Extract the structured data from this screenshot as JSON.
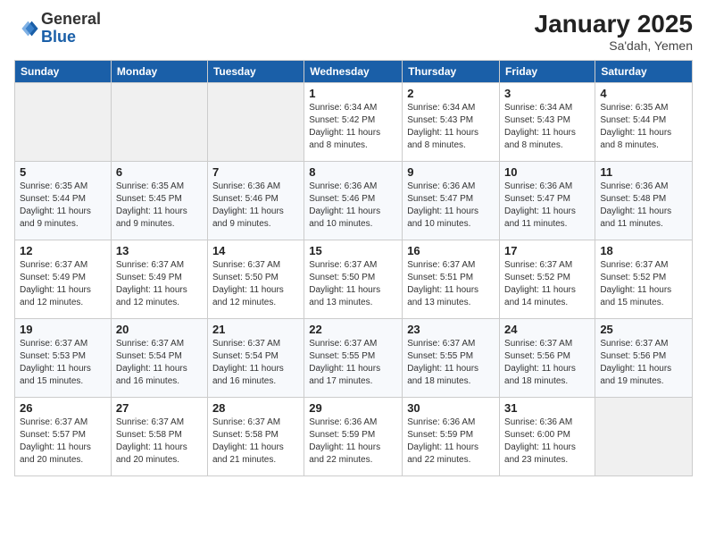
{
  "logo": {
    "line1": "General",
    "line2": "Blue"
  },
  "title": "January 2025",
  "subtitle": "Sa'dah, Yemen",
  "weekdays": [
    "Sunday",
    "Monday",
    "Tuesday",
    "Wednesday",
    "Thursday",
    "Friday",
    "Saturday"
  ],
  "weeks": [
    [
      {
        "day": "",
        "info": ""
      },
      {
        "day": "",
        "info": ""
      },
      {
        "day": "",
        "info": ""
      },
      {
        "day": "1",
        "info": "Sunrise: 6:34 AM\nSunset: 5:42 PM\nDaylight: 11 hours\nand 8 minutes."
      },
      {
        "day": "2",
        "info": "Sunrise: 6:34 AM\nSunset: 5:43 PM\nDaylight: 11 hours\nand 8 minutes."
      },
      {
        "day": "3",
        "info": "Sunrise: 6:34 AM\nSunset: 5:43 PM\nDaylight: 11 hours\nand 8 minutes."
      },
      {
        "day": "4",
        "info": "Sunrise: 6:35 AM\nSunset: 5:44 PM\nDaylight: 11 hours\nand 8 minutes."
      }
    ],
    [
      {
        "day": "5",
        "info": "Sunrise: 6:35 AM\nSunset: 5:44 PM\nDaylight: 11 hours\nand 9 minutes."
      },
      {
        "day": "6",
        "info": "Sunrise: 6:35 AM\nSunset: 5:45 PM\nDaylight: 11 hours\nand 9 minutes."
      },
      {
        "day": "7",
        "info": "Sunrise: 6:36 AM\nSunset: 5:46 PM\nDaylight: 11 hours\nand 9 minutes."
      },
      {
        "day": "8",
        "info": "Sunrise: 6:36 AM\nSunset: 5:46 PM\nDaylight: 11 hours\nand 10 minutes."
      },
      {
        "day": "9",
        "info": "Sunrise: 6:36 AM\nSunset: 5:47 PM\nDaylight: 11 hours\nand 10 minutes."
      },
      {
        "day": "10",
        "info": "Sunrise: 6:36 AM\nSunset: 5:47 PM\nDaylight: 11 hours\nand 11 minutes."
      },
      {
        "day": "11",
        "info": "Sunrise: 6:36 AM\nSunset: 5:48 PM\nDaylight: 11 hours\nand 11 minutes."
      }
    ],
    [
      {
        "day": "12",
        "info": "Sunrise: 6:37 AM\nSunset: 5:49 PM\nDaylight: 11 hours\nand 12 minutes."
      },
      {
        "day": "13",
        "info": "Sunrise: 6:37 AM\nSunset: 5:49 PM\nDaylight: 11 hours\nand 12 minutes."
      },
      {
        "day": "14",
        "info": "Sunrise: 6:37 AM\nSunset: 5:50 PM\nDaylight: 11 hours\nand 12 minutes."
      },
      {
        "day": "15",
        "info": "Sunrise: 6:37 AM\nSunset: 5:50 PM\nDaylight: 11 hours\nand 13 minutes."
      },
      {
        "day": "16",
        "info": "Sunrise: 6:37 AM\nSunset: 5:51 PM\nDaylight: 11 hours\nand 13 minutes."
      },
      {
        "day": "17",
        "info": "Sunrise: 6:37 AM\nSunset: 5:52 PM\nDaylight: 11 hours\nand 14 minutes."
      },
      {
        "day": "18",
        "info": "Sunrise: 6:37 AM\nSunset: 5:52 PM\nDaylight: 11 hours\nand 15 minutes."
      }
    ],
    [
      {
        "day": "19",
        "info": "Sunrise: 6:37 AM\nSunset: 5:53 PM\nDaylight: 11 hours\nand 15 minutes."
      },
      {
        "day": "20",
        "info": "Sunrise: 6:37 AM\nSunset: 5:54 PM\nDaylight: 11 hours\nand 16 minutes."
      },
      {
        "day": "21",
        "info": "Sunrise: 6:37 AM\nSunset: 5:54 PM\nDaylight: 11 hours\nand 16 minutes."
      },
      {
        "day": "22",
        "info": "Sunrise: 6:37 AM\nSunset: 5:55 PM\nDaylight: 11 hours\nand 17 minutes."
      },
      {
        "day": "23",
        "info": "Sunrise: 6:37 AM\nSunset: 5:55 PM\nDaylight: 11 hours\nand 18 minutes."
      },
      {
        "day": "24",
        "info": "Sunrise: 6:37 AM\nSunset: 5:56 PM\nDaylight: 11 hours\nand 18 minutes."
      },
      {
        "day": "25",
        "info": "Sunrise: 6:37 AM\nSunset: 5:56 PM\nDaylight: 11 hours\nand 19 minutes."
      }
    ],
    [
      {
        "day": "26",
        "info": "Sunrise: 6:37 AM\nSunset: 5:57 PM\nDaylight: 11 hours\nand 20 minutes."
      },
      {
        "day": "27",
        "info": "Sunrise: 6:37 AM\nSunset: 5:58 PM\nDaylight: 11 hours\nand 20 minutes."
      },
      {
        "day": "28",
        "info": "Sunrise: 6:37 AM\nSunset: 5:58 PM\nDaylight: 11 hours\nand 21 minutes."
      },
      {
        "day": "29",
        "info": "Sunrise: 6:36 AM\nSunset: 5:59 PM\nDaylight: 11 hours\nand 22 minutes."
      },
      {
        "day": "30",
        "info": "Sunrise: 6:36 AM\nSunset: 5:59 PM\nDaylight: 11 hours\nand 22 minutes."
      },
      {
        "day": "31",
        "info": "Sunrise: 6:36 AM\nSunset: 6:00 PM\nDaylight: 11 hours\nand 23 minutes."
      },
      {
        "day": "",
        "info": ""
      }
    ]
  ]
}
